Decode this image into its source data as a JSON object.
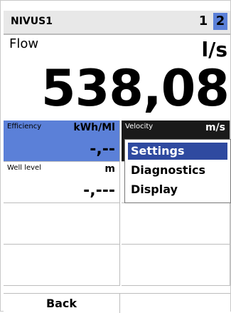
{
  "header": {
    "title": "NIVUS1",
    "pages": [
      "1",
      "2"
    ],
    "active_page": "2",
    "accent_color": "#5b80d8"
  },
  "main": {
    "label": "Flow",
    "unit": "l/s",
    "value": "538,08"
  },
  "cells": [
    {
      "label": "Efficiency",
      "unit": "kWh/Ml",
      "value": "-,--"
    },
    {
      "label": "Velocity",
      "unit": "m/s",
      "value": ""
    },
    {
      "label": "Well level",
      "unit": "m",
      "value": "-,---"
    },
    {
      "label": "",
      "unit": "",
      "value": ""
    },
    {
      "label": "",
      "unit": "",
      "value": ""
    },
    {
      "label": "",
      "unit": "",
      "value": ""
    },
    {
      "label": "",
      "unit": "",
      "value": ""
    },
    {
      "label": "",
      "unit": "",
      "value": ""
    }
  ],
  "menu": {
    "items": [
      "Settings",
      "Diagnostics",
      "Display"
    ],
    "selected": "Settings",
    "selected_color": "#2f4aa0"
  },
  "footer": {
    "back_label": "Back"
  }
}
